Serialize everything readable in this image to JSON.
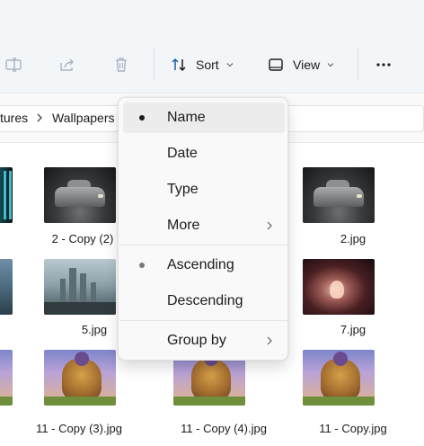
{
  "toolbar": {
    "sort_label": "Sort",
    "view_label": "View",
    "items": [
      {
        "name": "rename-button",
        "icon": "rename-icon"
      },
      {
        "name": "share-button",
        "icon": "share-icon"
      },
      {
        "name": "delete-button",
        "icon": "delete-icon"
      },
      {
        "name": "sort-button",
        "icon": "sort-icon"
      },
      {
        "name": "view-button",
        "icon": "view-icon"
      },
      {
        "name": "more-options-button",
        "icon": "more-icon"
      }
    ]
  },
  "address_bar": {
    "crumbs": [
      "tures",
      "Wallpapers"
    ]
  },
  "files": {
    "row1": [
      "2 - Copy (2)",
      "",
      "2.jpg"
    ],
    "row2": [
      "5.jpg",
      "",
      "7.jpg"
    ],
    "row3": [
      "11 - Copy (3).jpg",
      "11 - Copy (4).jpg",
      "11 - Copy.jpg"
    ]
  },
  "sort_menu": {
    "items": [
      {
        "label": "Name",
        "selected": true,
        "hover": true
      },
      {
        "label": "Date",
        "selected": false
      },
      {
        "label": "Type",
        "selected": false
      },
      {
        "label": "More",
        "submenu": true
      }
    ],
    "order_items": [
      {
        "label": "Ascending",
        "selected": true
      },
      {
        "label": "Descending",
        "selected": false
      }
    ],
    "group_items": [
      {
        "label": "Group by",
        "submenu": true
      }
    ]
  },
  "colors": {
    "toolbar_bg": "#f3f6f9",
    "menu_bg": "#f9f9f9",
    "hover_bg": "#ececec",
    "icon_disabled": "#a8b4c2",
    "accent": "#1b5fa8"
  }
}
